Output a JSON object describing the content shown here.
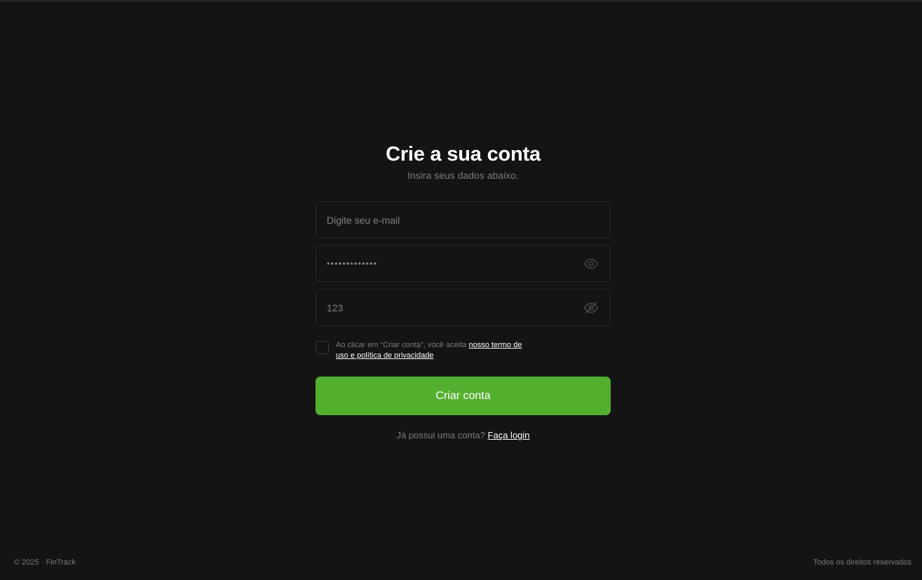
{
  "page": {
    "title": "Crie a sua conta",
    "subtitle": "Insira seus dados abaixo."
  },
  "form": {
    "email": {
      "placeholder": "Digite seu e-mail",
      "value": ""
    },
    "password": {
      "value": "•••••••••••••",
      "toggle_icon": "eye-icon"
    },
    "confirm_password": {
      "value": "123",
      "toggle_icon": "eye-off-icon"
    },
    "terms": {
      "checked": false,
      "prefix": "Ao clicar em “Criar conta”, você aceita ",
      "link_label": "nosso termo de uso e política de privacidade"
    },
    "submit_label": "Criar conta"
  },
  "login_prompt": {
    "text": "Já possui uma conta?",
    "link_label": "Faça login"
  },
  "footer": {
    "copyright": "© 2025 · FinTrack",
    "rights": "Todos os direitos reservados"
  },
  "colors": {
    "background": "#141414",
    "accent": "#53b02f",
    "muted_text": "#7b7b7b",
    "border": "#2a2a2a"
  }
}
